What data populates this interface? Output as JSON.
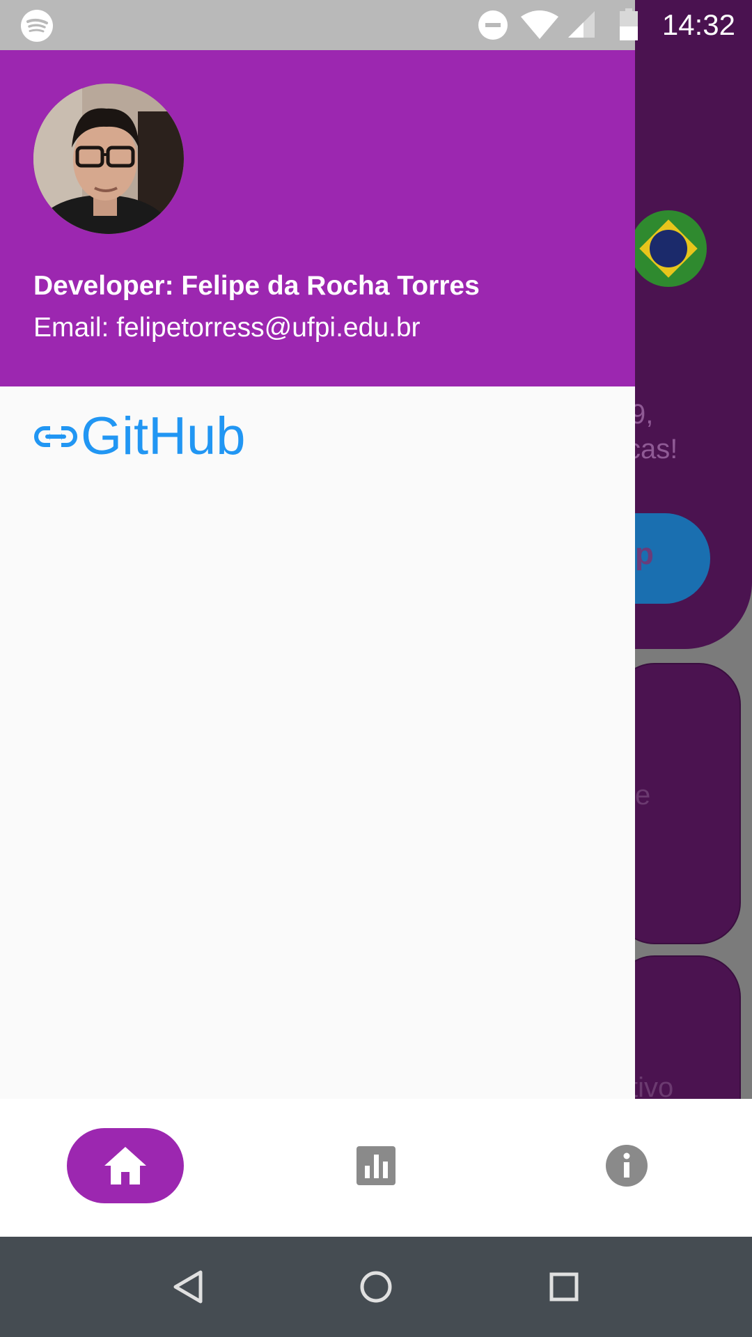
{
  "status_bar": {
    "time": "14:32",
    "icons": [
      "spotify-icon",
      "do-not-disturb-icon",
      "wifi-icon",
      "cellular-signal-icon",
      "battery-icon"
    ]
  },
  "background_app": {
    "text_lines": [
      "9,",
      "cas!",
      "e",
      "tivo"
    ],
    "button_label_fragment": "p"
  },
  "drawer": {
    "header": {
      "developer": "Developer: Felipe da Rocha Torres",
      "email": "Email: felipetorress@ufpi.edu.br"
    },
    "links": [
      {
        "label": "GitHub",
        "icon": "link-icon"
      }
    ]
  },
  "bottom_nav": {
    "items": [
      {
        "icon": "home-icon",
        "active": true
      },
      {
        "icon": "bar-chart-icon",
        "active": false
      },
      {
        "icon": "info-icon",
        "active": false
      }
    ]
  },
  "colors": {
    "primary": "#9c27b0",
    "link": "#2196f3",
    "status_bar": "#b9b9b9",
    "system_nav": "#454c52",
    "inactive_icon": "#8a8a8a"
  }
}
